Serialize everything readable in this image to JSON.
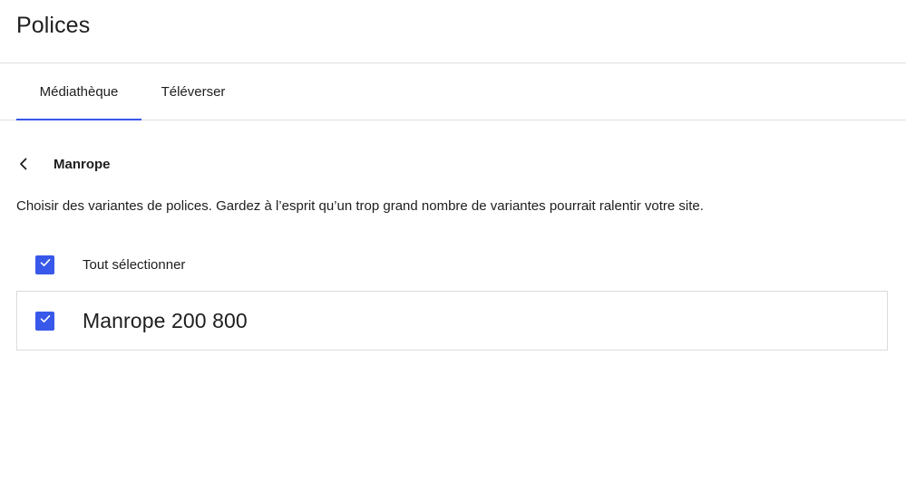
{
  "header": {
    "title": "Polices"
  },
  "tabs": [
    {
      "label": "Médiathèque",
      "active": true
    },
    {
      "label": "Téléverser",
      "active": false
    }
  ],
  "font": {
    "name": "Manrope",
    "back_icon": "chevron-left-icon"
  },
  "description": "Choisir des variantes de polices. Gardez à l’esprit qu’un trop grand nombre de variantes pourrait ralentir votre site.",
  "select_all": {
    "label": "Tout sélectionner",
    "checked": true
  },
  "variants": [
    {
      "label": "Manrope 200 800",
      "checked": true
    }
  ],
  "colors": {
    "accent": "#3858e9",
    "text": "#1e1e1e",
    "border": "#e0e0e0"
  }
}
